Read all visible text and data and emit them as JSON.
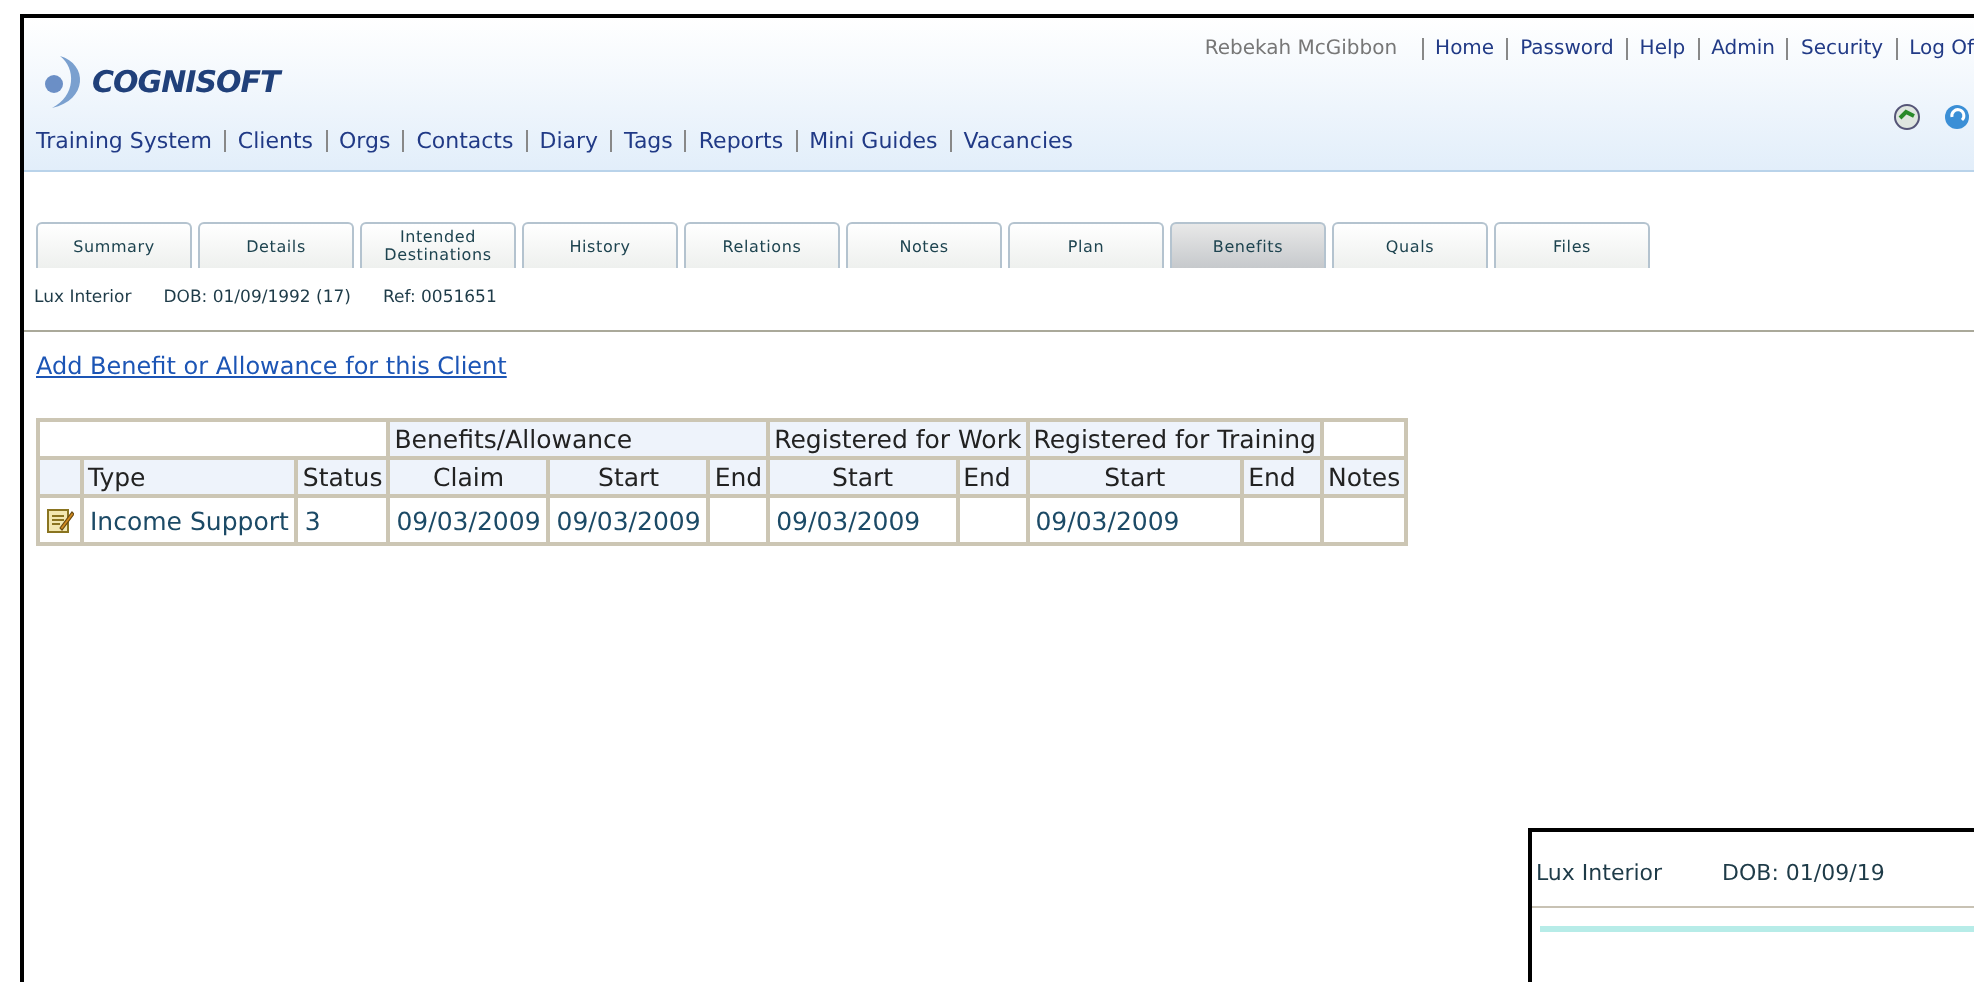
{
  "header": {
    "logo": "COGNISOFT",
    "user": "Rebekah McGibbon",
    "user_links": [
      "Home",
      "Password",
      "Help",
      "Admin",
      "Security",
      "Log Of"
    ],
    "nav": [
      "Training System",
      "Clients",
      "Orgs",
      "Contacts",
      "Diary",
      "Tags",
      "Reports",
      "Mini Guides",
      "Vacancies"
    ]
  },
  "tabs": [
    {
      "label": "Summary",
      "selected": false
    },
    {
      "label": "Details",
      "selected": false
    },
    {
      "label": "Intended Destinations",
      "selected": false
    },
    {
      "label": "History",
      "selected": false
    },
    {
      "label": "Relations",
      "selected": false
    },
    {
      "label": "Notes",
      "selected": false
    },
    {
      "label": "Plan",
      "selected": false
    },
    {
      "label": "Benefits",
      "selected": true
    },
    {
      "label": "Quals",
      "selected": false
    },
    {
      "label": "Files",
      "selected": false
    }
  ],
  "client": {
    "name": "Lux Interior",
    "dob": "DOB: 01/09/1992 (17)",
    "ref": "Ref: 0051651"
  },
  "add_link": "Add Benefit or Allowance for this Client",
  "table": {
    "groups": [
      "Benefits/Allowance",
      "Registered for Work",
      "Registered for Training"
    ],
    "columns": [
      "Type",
      "Status",
      "Claim",
      "Start",
      "End",
      "Start",
      "End",
      "Start",
      "End",
      "Notes"
    ],
    "rows": [
      {
        "type": "Income Support",
        "status": "3",
        "claim": "09/03/2009",
        "start": "09/03/2009",
        "work_start": "09/03/2009",
        "training_start": "09/03/2009"
      }
    ]
  },
  "inset": {
    "name": "Lux Interior",
    "dob": "DOB: 01/09/19"
  }
}
